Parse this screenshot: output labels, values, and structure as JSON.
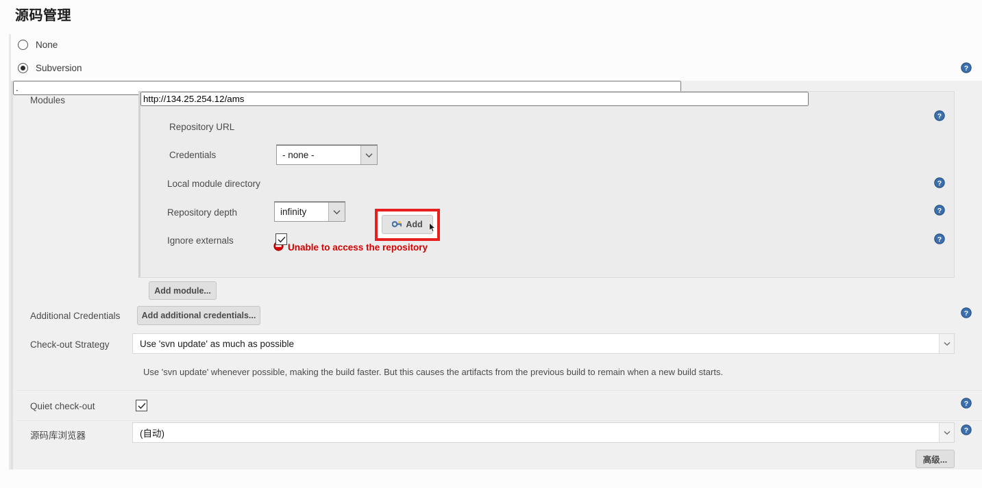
{
  "page": {
    "title": "源码管理"
  },
  "scm_type": {
    "options": [
      {
        "label": "None",
        "selected": false
      },
      {
        "label": "Subversion",
        "selected": true
      }
    ]
  },
  "modules": {
    "label": "Modules",
    "repository_url": {
      "label": "Repository URL",
      "value": "http://134.25.254.12/ams"
    },
    "credentials": {
      "label": "Credentials",
      "value": "- none -",
      "add_button": "Add",
      "add_button_icon": "key-icon",
      "error": {
        "icon": "no-entry-icon",
        "text": "Unable to access the repository"
      }
    },
    "local_module_directory": {
      "label": "Local module directory",
      "value": "."
    },
    "repository_depth": {
      "label": "Repository depth",
      "value": "infinity"
    },
    "ignore_externals": {
      "label": "Ignore externals",
      "checked": true
    },
    "add_module_button": "Add module..."
  },
  "additional_credentials": {
    "label": "Additional Credentials",
    "button": "Add additional credentials..."
  },
  "checkout_strategy": {
    "label": "Check-out Strategy",
    "value": "Use 'svn update' as much as possible",
    "description": "Use 'svn update' whenever possible, making the build faster. But this causes the artifacts from the previous build to remain when a new build starts."
  },
  "quiet_checkout": {
    "label": "Quiet check-out",
    "checked": true
  },
  "repository_browser": {
    "label": "源码库浏览器",
    "value": "(自动)"
  },
  "advanced_button": {
    "label": "高级..."
  },
  "colors": {
    "error_red": "#d40000",
    "highlight_red": "#e81f1f",
    "help_blue": "#3c6fae",
    "panel_bg": "#f0f0f0",
    "inner_bg": "#ececec"
  }
}
